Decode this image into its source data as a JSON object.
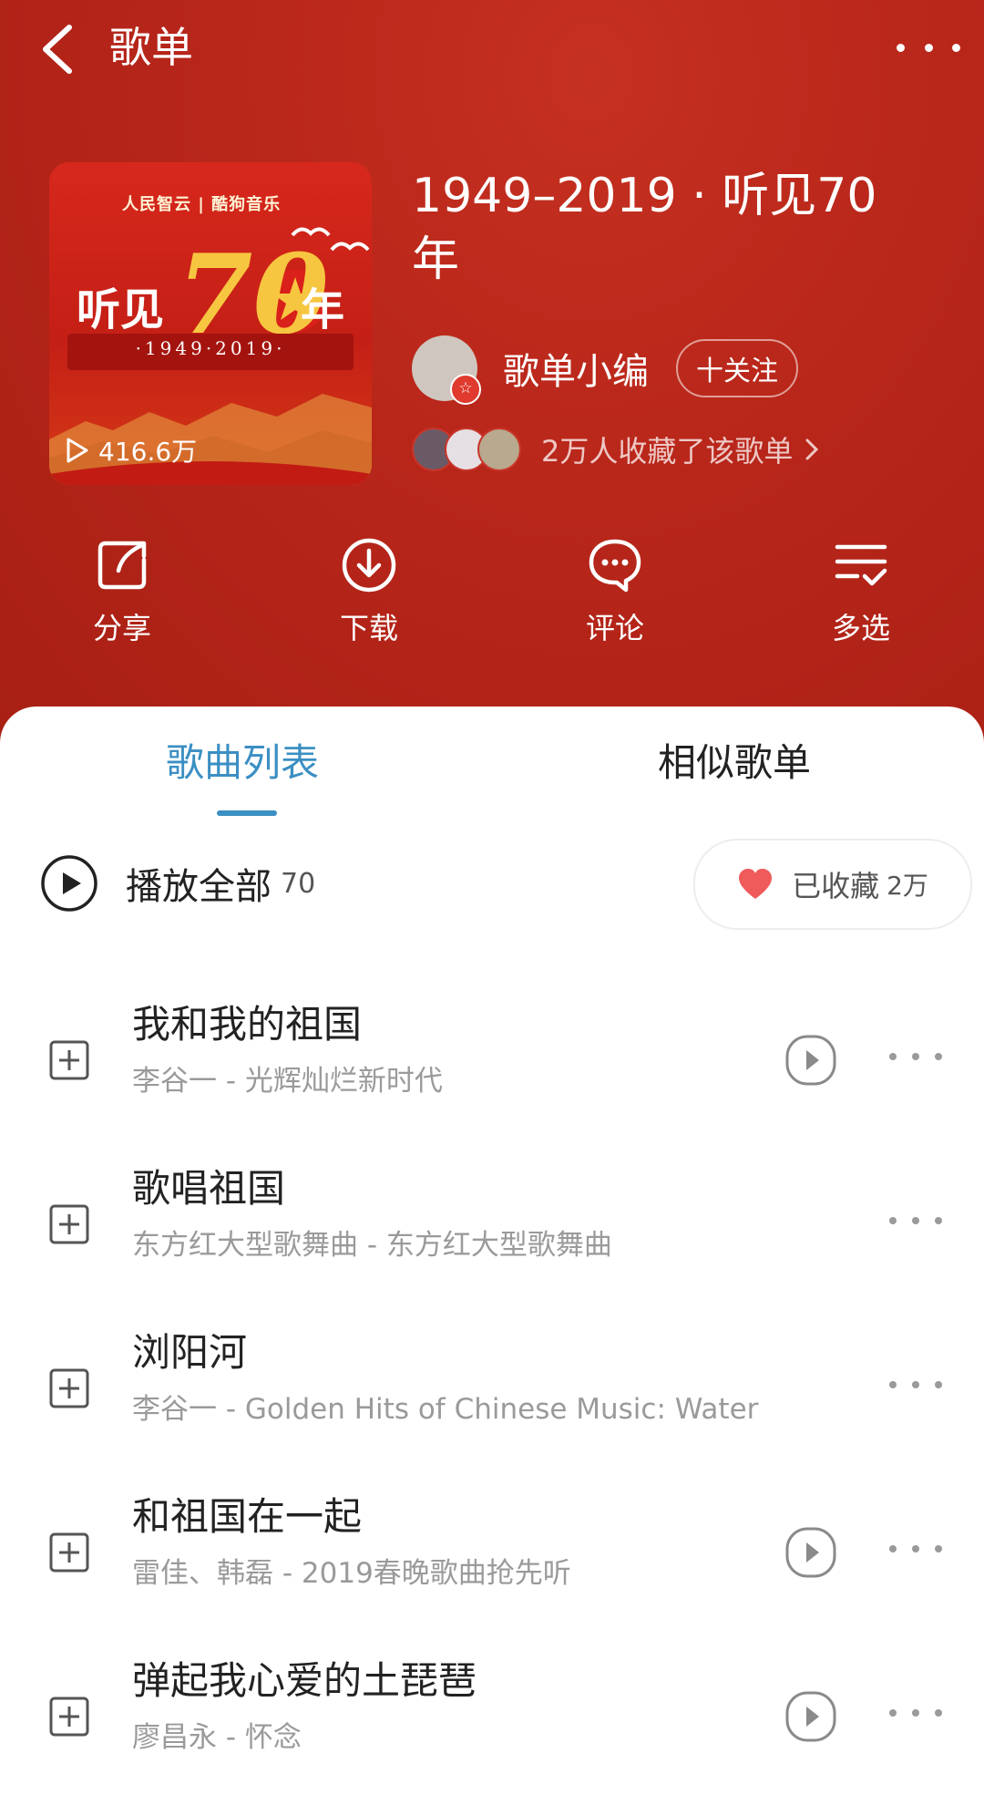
{
  "topbar": {
    "title": "歌单"
  },
  "cover": {
    "logo_text": "人民智云 | 酷狗音乐",
    "headline_left": "听见",
    "headline_big": "70",
    "headline_right": "年",
    "years": "·1949·2019·",
    "play_count": "416.6万"
  },
  "playlist": {
    "title": "1949–2019 · 听见70年",
    "creator": {
      "name": "歌单小编",
      "follow_label": "十关注"
    },
    "fans_text": "2万人收藏了该歌单"
  },
  "actions": [
    {
      "label": "分享",
      "icon": "share-icon"
    },
    {
      "label": "下载",
      "icon": "download-icon"
    },
    {
      "label": "评论",
      "icon": "comment-icon"
    },
    {
      "label": "多选",
      "icon": "multi-select-icon"
    }
  ],
  "tabs": [
    {
      "label": "歌曲列表",
      "active": true
    },
    {
      "label": "相似歌单",
      "active": false
    }
  ],
  "play_all": {
    "label": "播放全部",
    "count": "70"
  },
  "collect": {
    "label": "已收藏",
    "count": "2万"
  },
  "songs": [
    {
      "title": "我和我的祖国",
      "subtitle": "李谷一 - 光辉灿烂新时代",
      "has_mv": true
    },
    {
      "title": "歌唱祖国",
      "subtitle": "东方红大型歌舞曲 - 东方红大型歌舞曲",
      "has_mv": false
    },
    {
      "title": "浏阳河",
      "subtitle": "李谷一 - Golden Hits of Chinese Music: Water",
      "has_mv": false
    },
    {
      "title": "和祖国在一起",
      "subtitle": "雷佳、韩磊 - 2019春晚歌曲抢先听",
      "has_mv": true
    },
    {
      "title": "弹起我心爱的土琵琶",
      "subtitle": "廖昌永 - 怀念",
      "has_mv": true
    }
  ],
  "colors": {
    "header_red": "#b8261a",
    "tab_accent": "#3b8fc3",
    "heart": "#ef5a5a"
  }
}
